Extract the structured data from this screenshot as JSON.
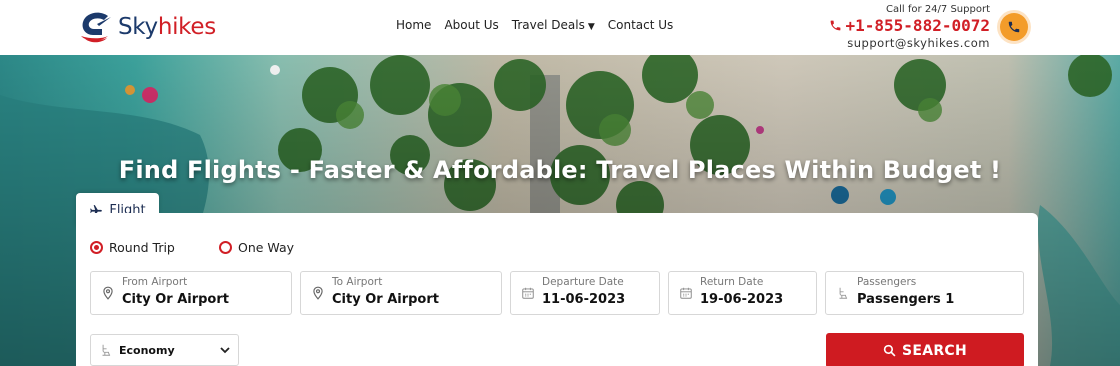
{
  "brand": {
    "name_part1": "Sky",
    "name_part2": "hikes"
  },
  "nav": {
    "items": [
      "Home",
      "About Us",
      "Travel Deals",
      "Contact Us"
    ]
  },
  "support": {
    "label": "Call for 24/7 Support",
    "phone": "+1-855-882-0072",
    "email": "support@skyhikes.com"
  },
  "hero": {
    "title": "Find Flights - Faster & Affordable: Travel Places Within Budget !"
  },
  "tab": {
    "label": "Flight"
  },
  "trip_type": {
    "round_trip": "Round Trip",
    "one_way": "One Way",
    "selected": "Round Trip"
  },
  "fields": {
    "from": {
      "label": "From Airport",
      "value": "City Or Airport"
    },
    "to": {
      "label": "To Airport",
      "value": "City Or Airport"
    },
    "departure": {
      "label": "Departure Date",
      "value": "11-06-2023"
    },
    "return": {
      "label": "Return Date",
      "value": "19-06-2023"
    },
    "passengers": {
      "label": "Passengers",
      "value": "Passengers 1"
    }
  },
  "cabin": {
    "value": "Economy"
  },
  "search": {
    "label": "SEARCH"
  },
  "colors": {
    "brand_red": "#d11f26",
    "brand_navy": "#1c3a6b",
    "accent_orange": "#f39c2a"
  }
}
